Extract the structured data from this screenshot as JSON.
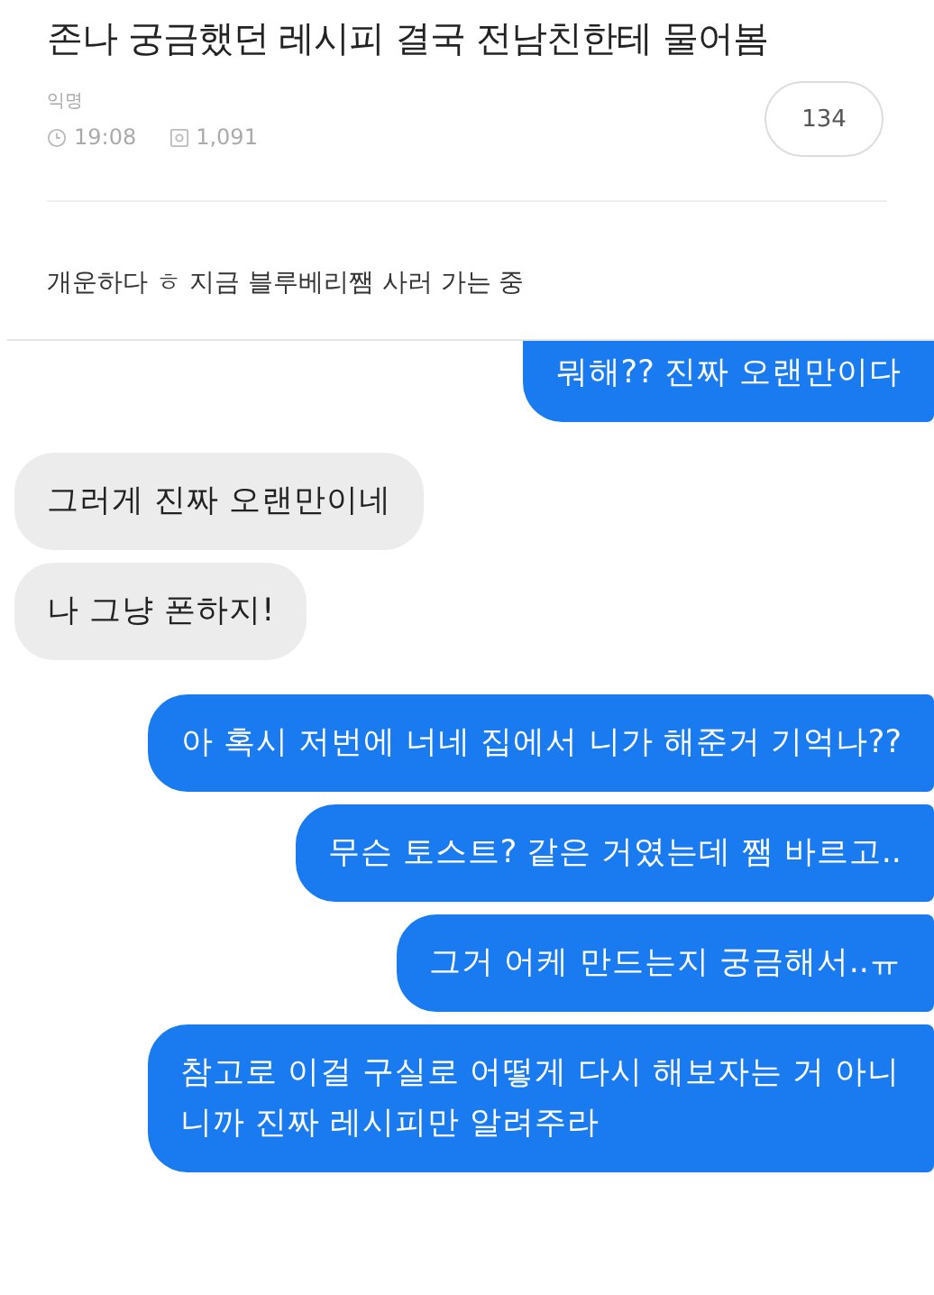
{
  "post": {
    "title": "존나 궁금했던 레시피 결국 전남친한테 물어봄",
    "author": "익명",
    "time": "19:08",
    "views": "1,091",
    "comments": "134",
    "body": "개운하다 ㅎ 지금 블루베리쨈 사러 가는 중"
  },
  "messages": [
    {
      "kind": "sent",
      "text": "뭐해?? 진짜 오랜만이다",
      "cut": true
    },
    {
      "kind": "received",
      "text": "그러게 진짜 오랜만이네"
    },
    {
      "kind": "received",
      "text": "나 그냥 폰하지!"
    },
    {
      "kind": "sent",
      "text": "아 혹시 저번에 너네 집에서 니가 해준거 기억나??"
    },
    {
      "kind": "sent",
      "text": "무슨 토스트? 같은 거였는데 쨈 바르고.."
    },
    {
      "kind": "sent",
      "text": "그거 어케 만드는지 궁금해서..ㅠ"
    },
    {
      "kind": "sent",
      "text": "참고로 이걸 구실로 어떻게 다시 해보자는 거 아니니까 진짜 레시피만 알려주라"
    }
  ]
}
